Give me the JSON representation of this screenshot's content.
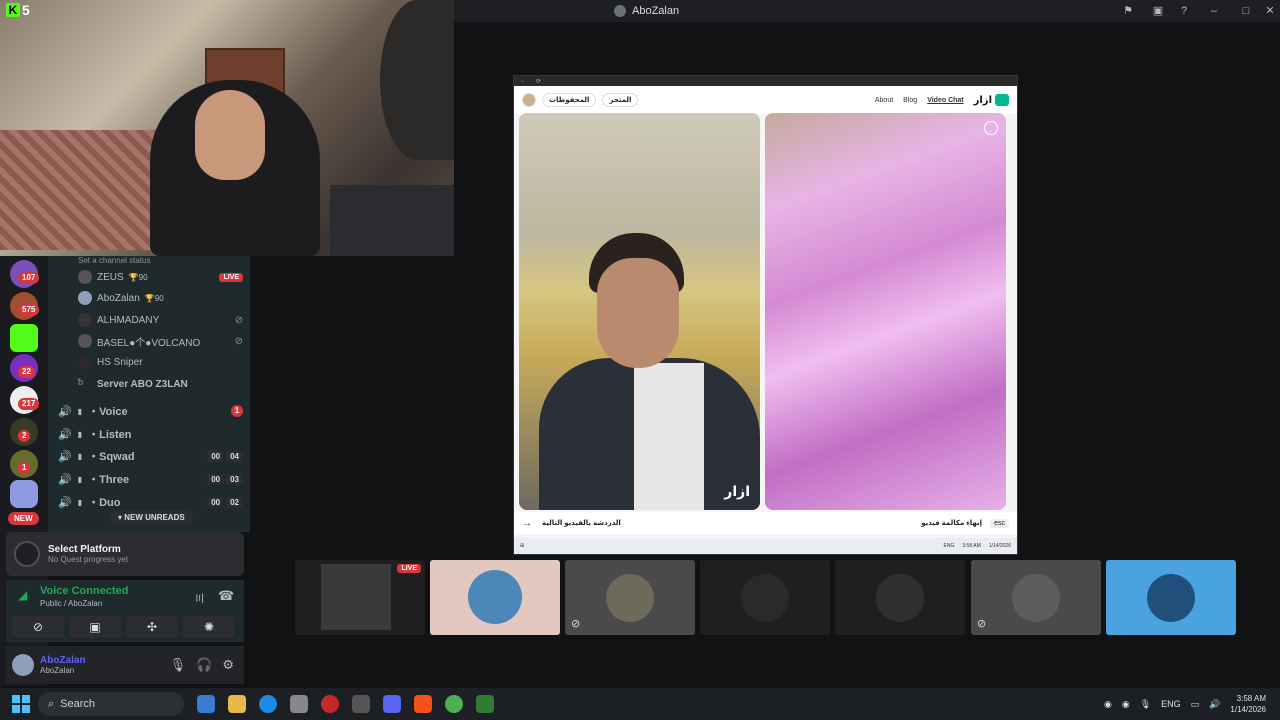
{
  "window": {
    "title": "AboZalan"
  },
  "webcam": {
    "badge": "5"
  },
  "servers": [
    {
      "badge": "107"
    },
    {
      "badge": "575"
    },
    {
      "badge": ""
    },
    {
      "badge": "22"
    },
    {
      "badge": "217"
    },
    {
      "badge": "2"
    },
    {
      "badge": "1"
    },
    {
      "badge": ""
    }
  ],
  "server_new": "NEW",
  "channel": {
    "status_hint": "Set a channel status",
    "members": [
      {
        "name": "ZEUS",
        "extra": "🏆90",
        "live": "LIVE"
      },
      {
        "name": "AboZalan",
        "extra": "🏆90"
      },
      {
        "name": "ALHMADANY"
      },
      {
        "name": "BASEL●个●VOLCANO"
      },
      {
        "name": "HS Sniper"
      },
      {
        "name": "Server ABO Z3LAN"
      }
    ],
    "voice_channels": [
      {
        "name": "・Voice",
        "badge": "1"
      },
      {
        "name": "・Listen"
      },
      {
        "name": "・Sqwad",
        "c1": "00",
        "c2": "04"
      },
      {
        "name": "・Three",
        "c1": "00",
        "c2": "03"
      },
      {
        "name": "・Duo",
        "c1": "00",
        "c2": "02"
      }
    ],
    "new_unreads": "NEW UNREADS"
  },
  "quest": {
    "title": "Select Platform",
    "subtitle": "No Quest progress yet"
  },
  "voice": {
    "status": "Voice Connected",
    "channel": "Public / AboZalan"
  },
  "user": {
    "display": "AboZalan",
    "username": "AboZalan"
  },
  "stream": {
    "pill_saved": "المحفوظات",
    "pill_store": "المتجر",
    "nav": [
      "About",
      "Blog",
      "Video Chat"
    ],
    "brand": "ازار",
    "watermark": "ازار",
    "chat_title": "الدردشة بالفيديو التالية",
    "end_call": "إنهاء مكالمة فيديو",
    "esc": "esc",
    "lang": "ENG",
    "time": "3:58 AM",
    "date": "1/14/2026"
  },
  "tiles": [
    {
      "live": "LIVE"
    },
    {},
    {},
    {},
    {},
    {},
    {}
  ],
  "taskbar": {
    "search_placeholder": "Search",
    "lang": "ENG",
    "time": "3:58 AM",
    "date": "1/14/2026"
  },
  "colors": {
    "discord_red": "#da373c",
    "green": "#23a55a",
    "accent": "#4cc2ff"
  }
}
